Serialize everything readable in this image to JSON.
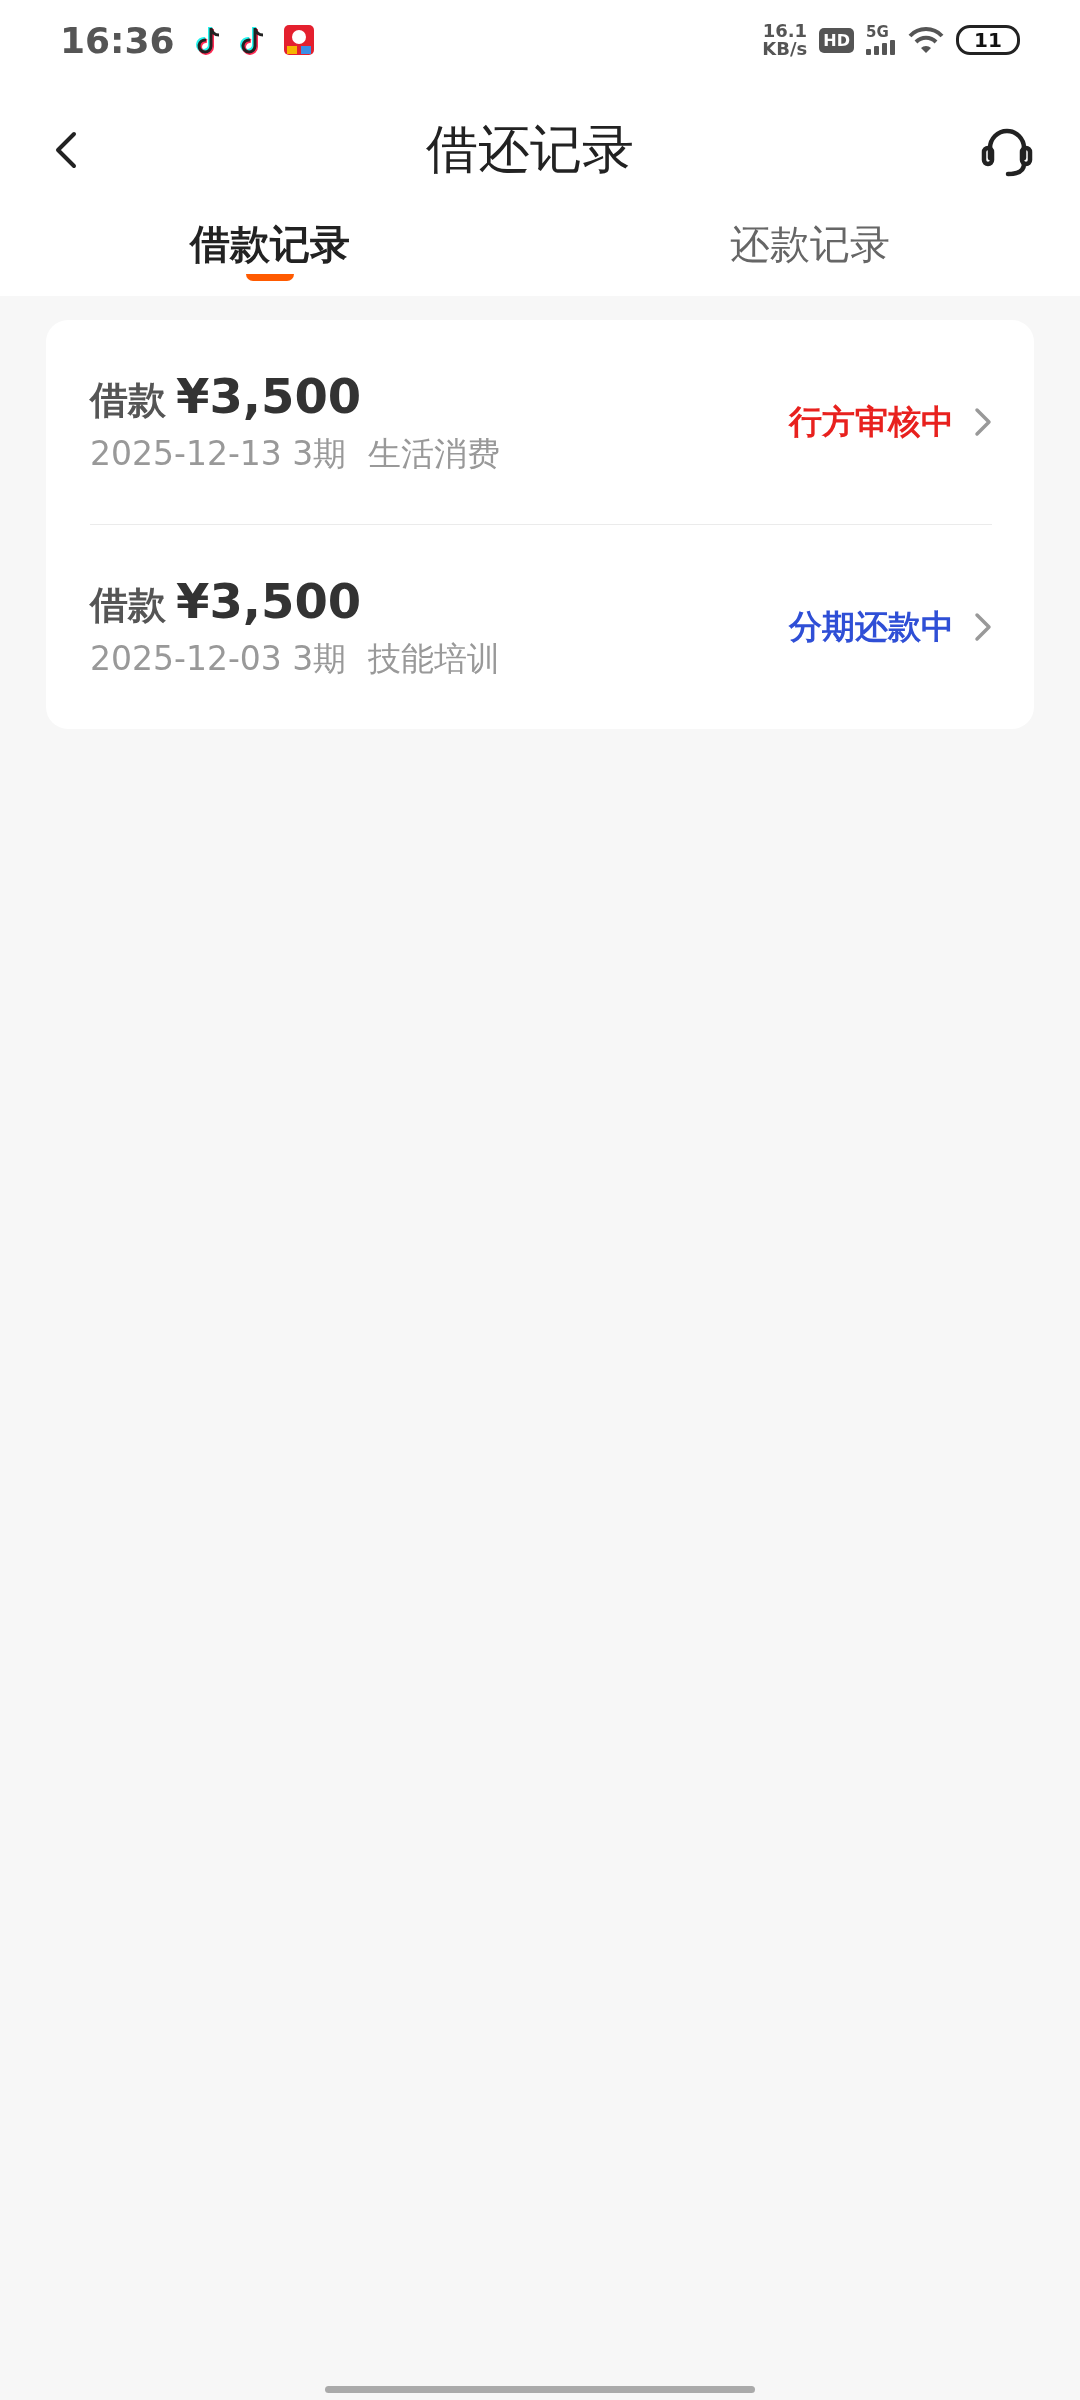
{
  "status_bar": {
    "time": "16:36",
    "speed": "16.1",
    "speed_unit": "KB/s",
    "hd": "HD",
    "network": "5G",
    "battery": "11"
  },
  "header": {
    "title": "借还记录"
  },
  "tabs": [
    {
      "label": "借款记录",
      "selected": true
    },
    {
      "label": "还款记录",
      "selected": false
    }
  ],
  "records": [
    {
      "label": "借款",
      "amount": "¥3,500",
      "details": "2025-12-13 3期",
      "purpose": "生活消费",
      "status": "行方审核中",
      "color": "#e8211e"
    },
    {
      "label": "借款",
      "amount": "¥3,500",
      "details": "2025-12-03 3期",
      "purpose": "技能培训",
      "status": "分期还款中",
      "color": "#2f4fd6"
    }
  ]
}
